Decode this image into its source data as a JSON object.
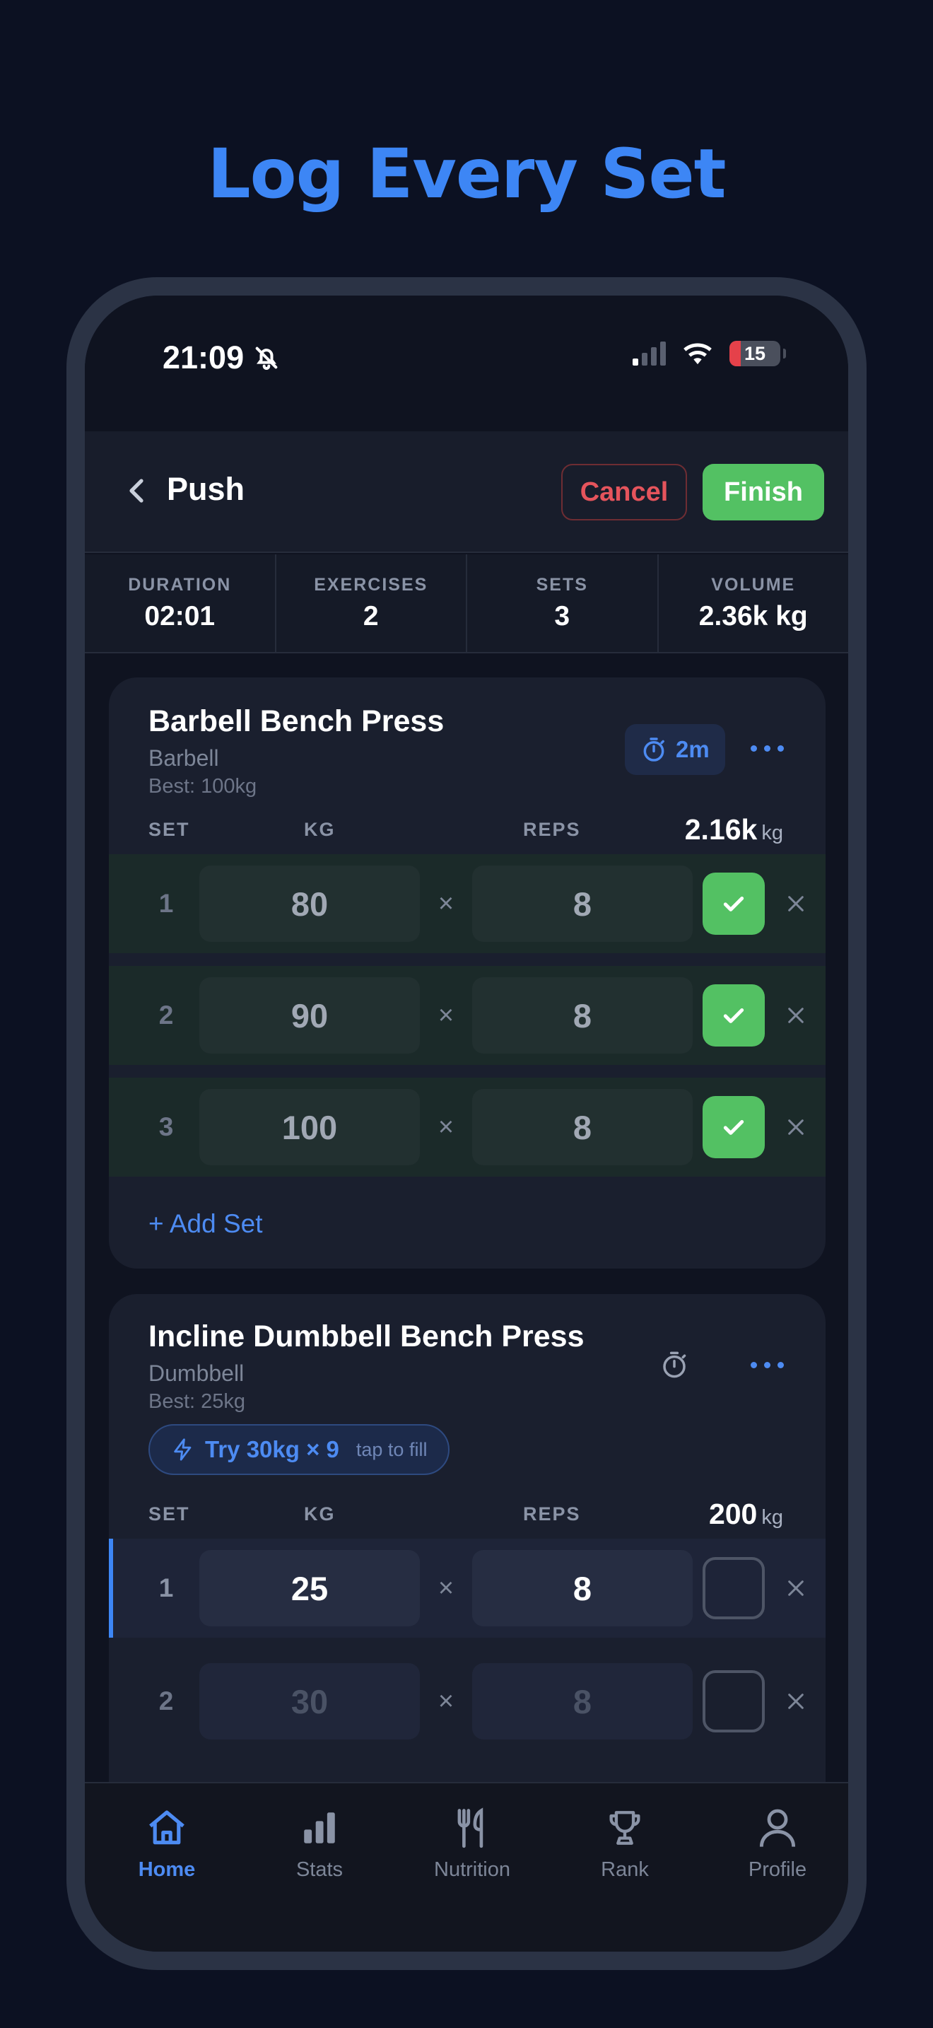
{
  "headline": "Log Every Set",
  "status_bar": {
    "time": "21:09",
    "battery": "15"
  },
  "header": {
    "title": "Push",
    "cancel_label": "Cancel",
    "finish_label": "Finish"
  },
  "stats": [
    {
      "label": "DURATION",
      "value": "02:01"
    },
    {
      "label": "EXERCISES",
      "value": "2"
    },
    {
      "label": "SETS",
      "value": "3"
    },
    {
      "label": "VOLUME",
      "value": "2.36k kg"
    }
  ],
  "columns": {
    "set": "SET",
    "kg": "KG",
    "reps": "REPS",
    "times": "×"
  },
  "exercises": [
    {
      "name": "Barbell Bench Press",
      "equipment": "Barbell",
      "best": "Best: 100kg",
      "rest_timer": "2m",
      "volume_value": "2.16k",
      "volume_unit": "kg",
      "sets": [
        {
          "num": "1",
          "kg": "80",
          "reps": "8",
          "done": true
        },
        {
          "num": "2",
          "kg": "90",
          "reps": "8",
          "done": true
        },
        {
          "num": "3",
          "kg": "100",
          "reps": "8",
          "done": true
        }
      ],
      "add_set_label": "+ Add Set"
    },
    {
      "name": "Incline Dumbbell Bench Press",
      "equipment": "Dumbbell",
      "best": "Best: 25kg",
      "suggestion": {
        "text": "Try 30kg × 9",
        "hint": "tap to fill"
      },
      "volume_value": "200",
      "volume_unit": "kg",
      "sets": [
        {
          "num": "1",
          "kg": "25",
          "reps": "8",
          "done": false,
          "state": "active"
        },
        {
          "num": "2",
          "kg": "30",
          "reps": "8",
          "done": false,
          "state": "pending"
        }
      ]
    }
  ],
  "tabbar": [
    {
      "label": "Home",
      "icon": "home-icon",
      "active": true
    },
    {
      "label": "Stats",
      "icon": "bar-chart-icon",
      "active": false
    },
    {
      "label": "Nutrition",
      "icon": "fork-knife-icon",
      "active": false
    },
    {
      "label": "Rank",
      "icon": "trophy-icon",
      "active": false
    },
    {
      "label": "Profile",
      "icon": "person-icon",
      "active": false
    }
  ],
  "colors": {
    "accent": "#3d86f5",
    "success": "#53c163",
    "danger": "#e5545c",
    "background": "#0c1122"
  }
}
